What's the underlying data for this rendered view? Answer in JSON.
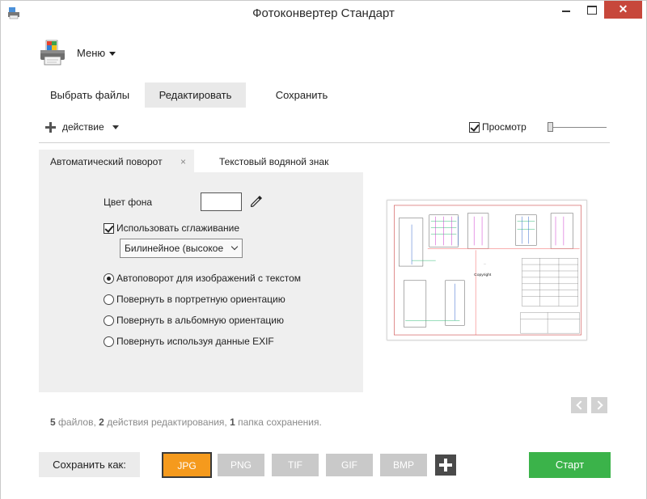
{
  "window": {
    "title": "Фотоконвертер Стандарт",
    "close_symbol": "✕"
  },
  "header": {
    "menu_label": "Меню"
  },
  "main_tabs": [
    {
      "label": "Выбрать файлы"
    },
    {
      "label": "Редактировать",
      "selected": true
    },
    {
      "label": "Сохранить"
    }
  ],
  "toolbar": {
    "action_label": "действие",
    "preview_label": "Просмотр",
    "preview_checked": true,
    "zoom_level": 0
  },
  "panel": {
    "tabs": [
      {
        "label": "Автоматический поворот",
        "close": "×",
        "active": true
      },
      {
        "label": "Текстовый водяной знак"
      }
    ],
    "bg_color_label": "Цвет фона",
    "bg_color_value": "#ffffff",
    "smoothing_label": "Использовать сглаживание",
    "smoothing_checked": true,
    "smoothing_select": "Билинейное (высокое",
    "radios": [
      {
        "label": "Автоповорот для изображений с текстом",
        "selected": true
      },
      {
        "label": "Повернуть в портретную ориентацию",
        "selected": false
      },
      {
        "label": "Повернуть в альбомную ориентацию",
        "selected": false
      },
      {
        "label": "Повернуть используя данные EXIF",
        "selected": false
      }
    ]
  },
  "preview": {
    "watermark_text": "Copyright"
  },
  "summary": {
    "files_count": "5",
    "files_text": "файлов,",
    "actions_count": "2",
    "actions_text": "действия редактирования,",
    "folders_count": "1",
    "folders_text": "папка сохранения."
  },
  "bottom": {
    "save_as_label": "Сохранить как:",
    "formats": [
      "JPG",
      "PNG",
      "TIF",
      "GIF",
      "BMP"
    ],
    "selected_format": "JPG",
    "start_label": "Старт"
  },
  "colors": {
    "accent_orange": "#f59a1d",
    "start_green": "#3bb34a",
    "close_red": "#c7473b"
  }
}
